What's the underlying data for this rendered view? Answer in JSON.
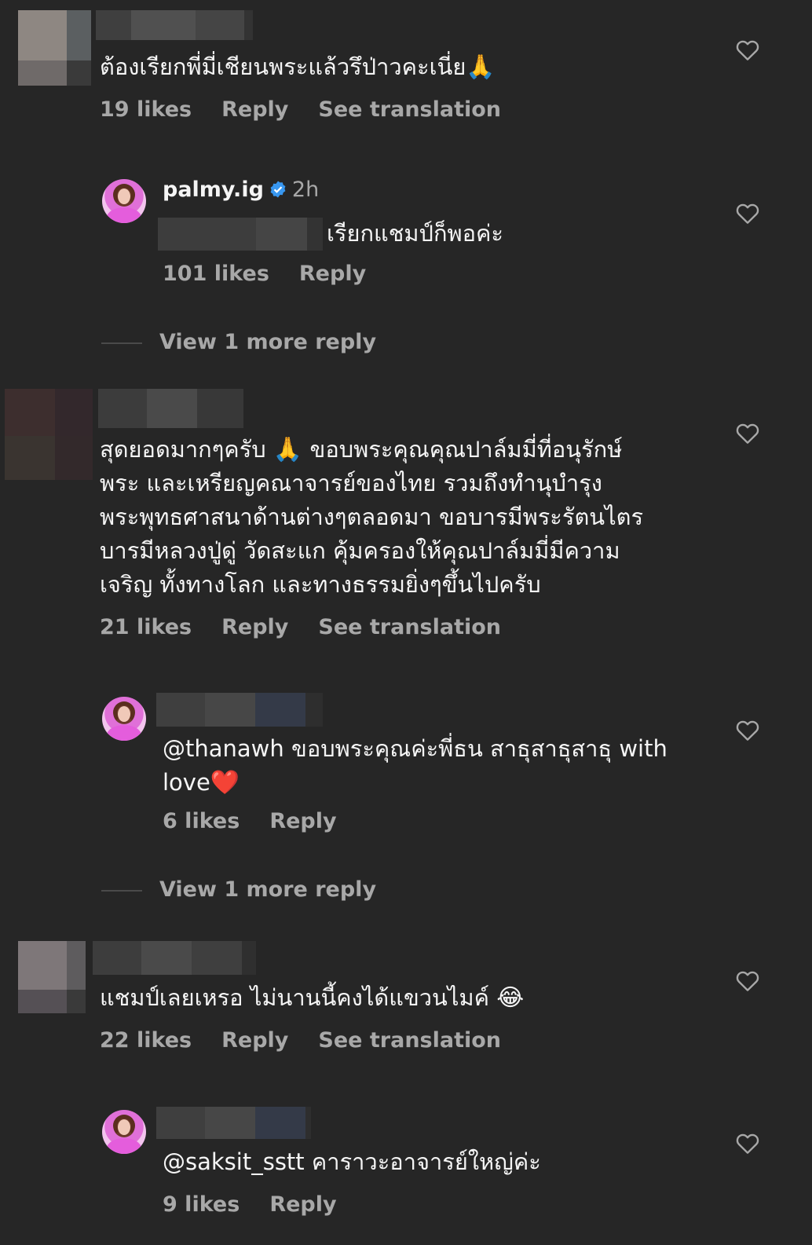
{
  "comments": [
    {
      "text": "ต้องเรียกพี่มี่เชียนพระแล้วรึป่าวคะเนี่ย",
      "emoji": "🙏",
      "likes": "19 likes",
      "reply_label": "Reply",
      "translate_label": "See translation",
      "reply": {
        "username": "palmy.ig",
        "time": "2h",
        "text": "เรียกแชมป์ก็พอค่ะ",
        "likes": "101 likes",
        "reply_label": "Reply"
      },
      "view_more": "View 1 more reply"
    },
    {
      "text_before_emoji": "สุดยอดมากๆครับ ",
      "emoji": "🙏",
      "text_after_emoji": " ขอบพระคุณคุณปาล์มมี่ที่อนุรักษ์พระ และเหรียญคณาจารย์ของไทย  รวมถึงทำนุบำรุงพระพุทธศาสนาด้านต่างๆตลอดมา  ขอบารมีพระรัตนไตรบารมีหลวงปู่ดู่ วัดสะแก คุ้มครองให้คุณปาล์มมี่มีความเจริญ ทั้งทางโลก และทางธรรมยิ่งๆขึ้นไปครับ",
      "lines": [
        "สุดยอดมากๆครับ",
        "ขอบพระคุณคุณปาล์มมี่ที่อนุรักษ์",
        "พระ และเหรียญคณาจารย์ของไทย  รวมถึงทำนุบำรุง",
        "พระพุทธศาสนาด้านต่างๆตลอดมา  ขอบารมีพระรัตนไตร",
        "บารมีหลวงปู่ดู่ วัดสะแก คุ้มครองให้คุณปาล์มมี่มีความ",
        "เจริญ ทั้งทางโลก และทางธรรมยิ่งๆขึ้นไปครับ"
      ],
      "likes": "21 likes",
      "reply_label": "Reply",
      "translate_label": "See translation",
      "reply": {
        "text_line1": "@thanawh ขอบพระคุณค่ะพี่ธน สาธุสาธุสาธุ with",
        "text_line2": "love",
        "emoji": "❤️",
        "likes": "6 likes",
        "reply_label": "Reply"
      },
      "view_more": "View 1 more reply"
    },
    {
      "text": "แชมป์เลยเหรอ ไม่นานนี้คงได้แขวนไมค์",
      "emoji": "😂",
      "likes": "22 likes",
      "reply_label": "Reply",
      "translate_label": "See translation",
      "reply": {
        "text": "@saksit_sstt คาราวะอาจารย์ใหญ่ค่ะ",
        "likes": "9 likes",
        "reply_label": "Reply"
      }
    }
  ],
  "colors": {
    "background": "#262626",
    "primary_text": "#f5f5f5",
    "secondary_text": "#a8a8a8",
    "verified": "#3897f0"
  },
  "icons": {
    "like": "heart-outline-icon",
    "verified": "verified-badge-icon"
  }
}
